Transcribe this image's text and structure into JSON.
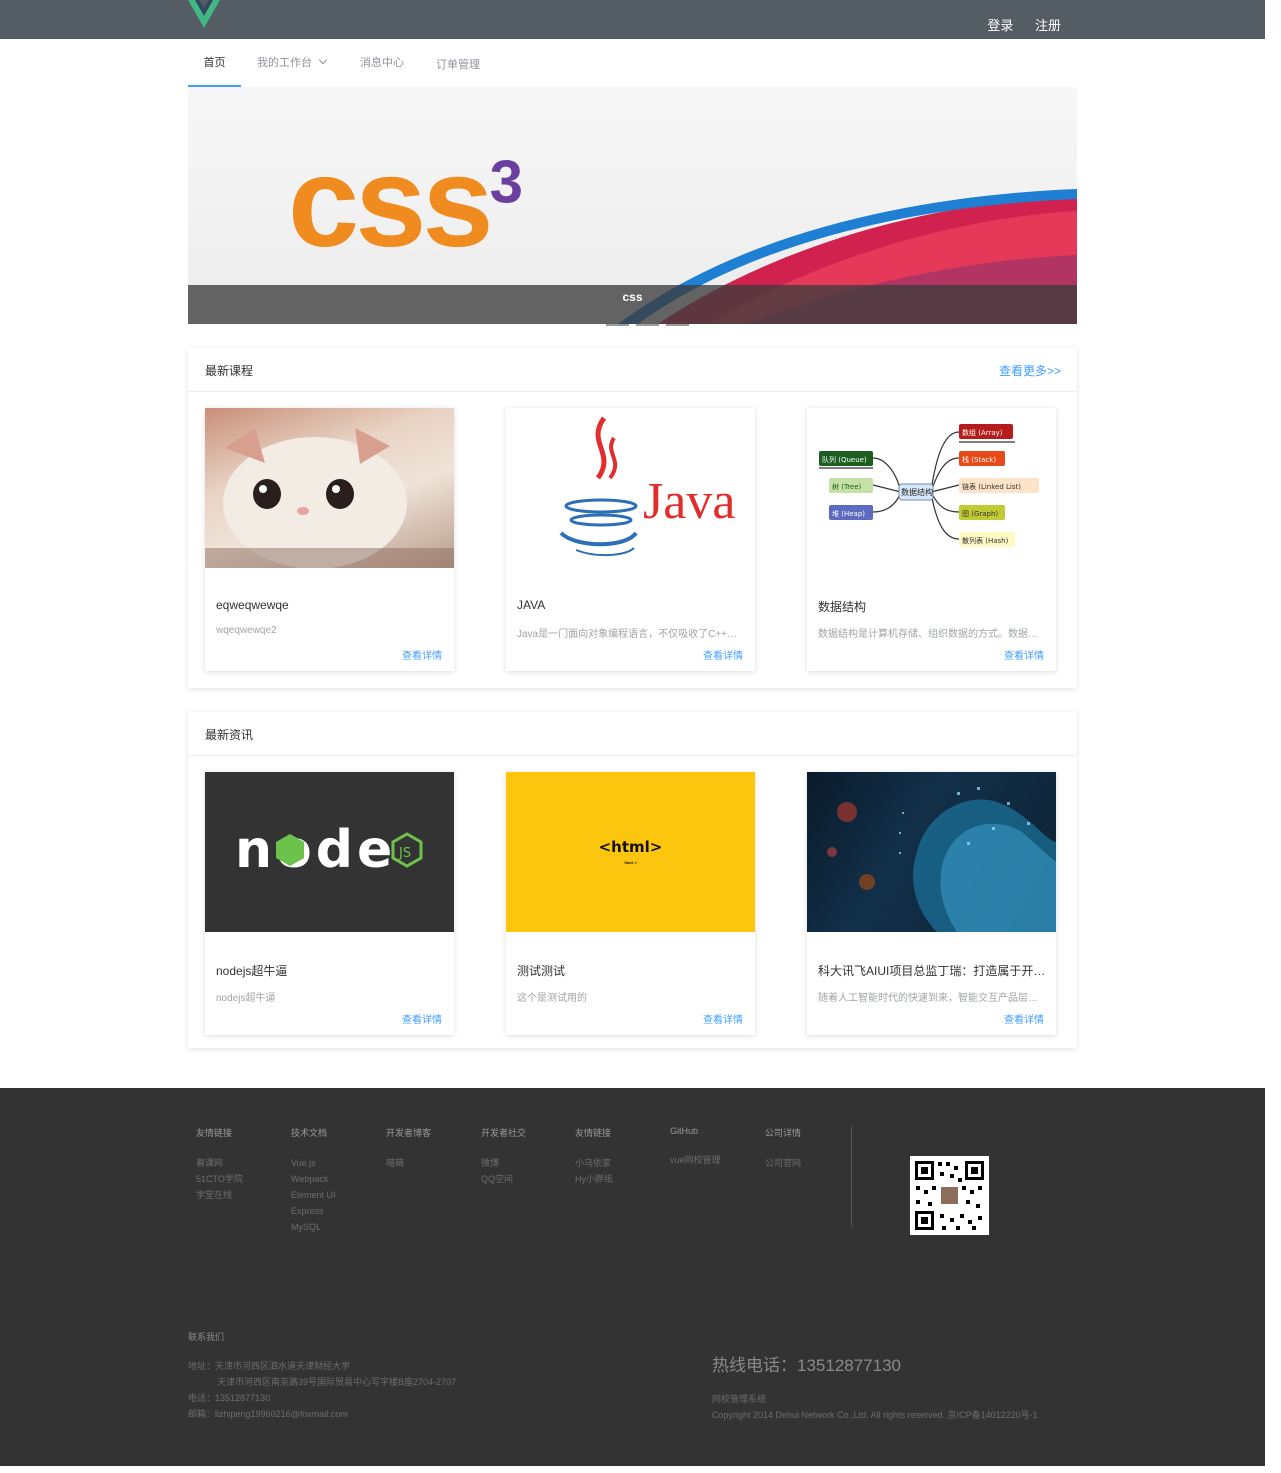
{
  "header": {
    "login": "登录",
    "register": "注册",
    "logo_icon": "vue-logo-icon",
    "colors": {
      "bar": "#545c64",
      "logo_green": "#41b883",
      "logo_dark": "#35495e"
    }
  },
  "nav": {
    "tabs": [
      {
        "label": "首页",
        "active": true
      },
      {
        "label": "我的工作台",
        "has_dropdown": true
      },
      {
        "label": "消息中心"
      },
      {
        "label": "订单管理"
      }
    ]
  },
  "banner": {
    "image_text": "css",
    "caption": "css",
    "indicators": 4,
    "active_indicator": 1
  },
  "courses": {
    "title": "最新课程",
    "more": "查看更多>>",
    "items": [
      {
        "title": "eqweqwewqe",
        "desc": "wqeqwewqe2",
        "link": "查看详情"
      },
      {
        "title": "JAVA",
        "desc": "Java是一门面向对象编程语言，不仅吸收了C++语言的各种优点",
        "link": "查看详情",
        "image_text": "Java"
      },
      {
        "title": "数据结构",
        "desc": "数据结构是计算机存储、组织数据的方式。数据结构是指相互之间",
        "link": "查看详情",
        "center": "数据结构",
        "nodes": [
          "数组 (Array)",
          "栈 (Stack)",
          "队列 (Queue)",
          "链表 (Linked List)",
          "树 (Tree)",
          "图 (Graph)",
          "堆 (Heap)",
          "散列表 (Hash)"
        ]
      }
    ]
  },
  "news": {
    "title": "最新资讯",
    "items": [
      {
        "title": "nodejs超牛逼",
        "desc": "nodejs超牛逼",
        "link": "查看详情",
        "image_text": "node"
      },
      {
        "title": "测试测试",
        "desc": "这个是测试用的",
        "link": "查看详情",
        "image_text": "<html>",
        "image_sub": "Start >"
      },
      {
        "title": "科大讯飞AIUI项目总监丁瑞：打造属于开发者的人工智能平台",
        "desc": "随着人工智能时代的快速到来，智能交互产品层出不穷",
        "link": "查看详情"
      }
    ]
  },
  "footer": {
    "columns": [
      {
        "title": "友情链接",
        "items": [
          "慕课网",
          "51CTO学院",
          "学堂在线"
        ]
      },
      {
        "title": "技术文档",
        "items": [
          "Vue.js",
          "Webpack",
          "Element UI",
          "Express",
          "MySQL"
        ]
      },
      {
        "title": "开发者博客",
        "items": [
          "喵萌"
        ]
      },
      {
        "title": "开发者社交",
        "items": [
          "微博",
          "QQ空间"
        ]
      },
      {
        "title": "友情链接",
        "items": [
          "小乌依家",
          "Hy小胖纸"
        ]
      },
      {
        "title": "GitHub",
        "items": [
          "vue网校管理"
        ]
      },
      {
        "title": "公司详情",
        "items": [
          "公司官网"
        ]
      }
    ],
    "contact": {
      "title": "联系我们",
      "address_label": "地址：",
      "address1": "天津市河西区泗水道天津财经大学",
      "address2": "天津市河西区南京路39号国际贸易中心写字楼B座2704-2707",
      "phone_label": "电话：",
      "phone": "13512877130",
      "email_label": "邮箱：",
      "email": "lizhipeng19960216@foxmail.com"
    },
    "hotline": "热线电话：13512877130",
    "system_name": "网校管理系统",
    "copyright": "Copyright 2014 Dehui Network Co.,Ltd. All rights reserved. 京ICP备14012220号-1",
    "qr_icon": "qr-code-icon"
  }
}
